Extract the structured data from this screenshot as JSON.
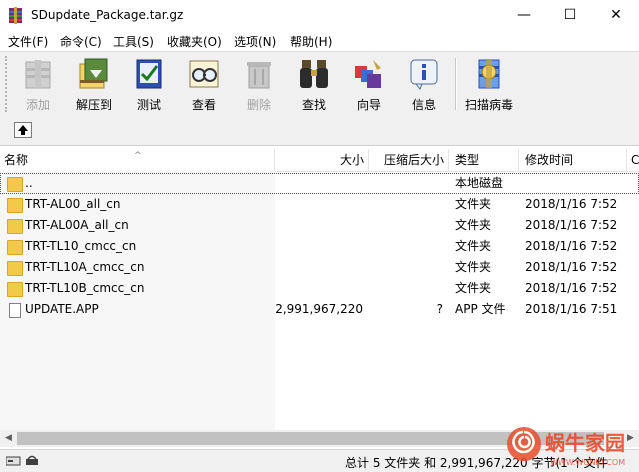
{
  "window": {
    "title": "SDupdate_Package.tar.gz",
    "minimize": "—",
    "maximize": "☐",
    "close": "✕"
  },
  "menu": [
    "文件(F)",
    "命令(C)",
    "工具(S)",
    "收藏夹(O)",
    "选项(N)",
    "帮助(H)"
  ],
  "toolbar": {
    "add": "添加",
    "extract": "解压到",
    "test": "测试",
    "view": "查看",
    "delete": "删除",
    "find": "查找",
    "wizard": "向导",
    "info": "信息",
    "virusscan": "扫描病毒"
  },
  "columns": {
    "name": "名称",
    "size": "大小",
    "packed": "压缩后大小",
    "type": "类型",
    "modified": "修改时间",
    "crc": "C"
  },
  "rows": [
    {
      "name": "..",
      "size": "",
      "packed": "",
      "type": "本地磁盘",
      "modified": "",
      "icon": "folder-icon"
    },
    {
      "name": "TRT-AL00_all_cn",
      "size": "",
      "packed": "",
      "type": "文件夹",
      "modified": "2018/1/16 7:52",
      "icon": "folder-icon"
    },
    {
      "name": "TRT-AL00A_all_cn",
      "size": "",
      "packed": "",
      "type": "文件夹",
      "modified": "2018/1/16 7:52",
      "icon": "folder-icon"
    },
    {
      "name": "TRT-TL10_cmcc_cn",
      "size": "",
      "packed": "",
      "type": "文件夹",
      "modified": "2018/1/16 7:52",
      "icon": "folder-icon"
    },
    {
      "name": "TRT-TL10A_cmcc_cn",
      "size": "",
      "packed": "",
      "type": "文件夹",
      "modified": "2018/1/16 7:52",
      "icon": "folder-icon"
    },
    {
      "name": "TRT-TL10B_cmcc_cn",
      "size": "",
      "packed": "",
      "type": "文件夹",
      "modified": "2018/1/16 7:52",
      "icon": "folder-icon"
    },
    {
      "name": "UPDATE.APP",
      "size": "2,991,967,220",
      "packed": "?",
      "type": "APP 文件",
      "modified": "2018/1/16 7:51",
      "icon": "file-icon"
    }
  ],
  "status": {
    "summary": "总计 5 文件夹 和 2,991,967,220 字节(1 个文件"
  },
  "watermark": {
    "text": "蜗牛家园",
    "sub": "WWW.WONIU.COM"
  },
  "colors": {
    "folder": "#f3c94a",
    "toolbar_bg": "#f0f0f0",
    "watermark": "#e84b2a"
  }
}
